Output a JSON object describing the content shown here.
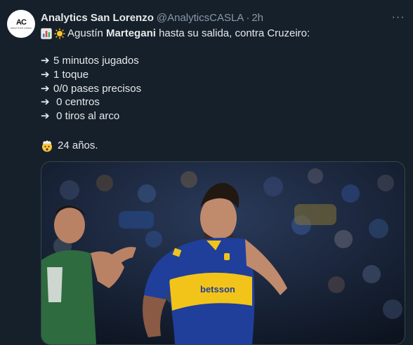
{
  "tweet": {
    "author_name": "Analytics San Lorenzo",
    "handle": "@AnalyticsCASLA",
    "separator": "·",
    "time": "2h",
    "avatar_text": "AC",
    "avatar_subtext": "ANALYTICS CASLA",
    "line1_pre": "Agustín ",
    "line1_bold": "Martegani",
    "line1_post": " hasta su salida, contra Cruzeiro:",
    "arrow": "➔",
    "stats": [
      "5 minutos jugados",
      "1 toque",
      "0/0 pases precisos",
      " 0 centros",
      " 0 tiros al arco"
    ],
    "age_text": "24 años.",
    "emojis": [
      "bar-chart-icon",
      "sun-icon",
      "exploding-head-icon"
    ]
  },
  "colors": {
    "background": "#15202b",
    "text": "#e7e9ea",
    "muted": "#8b98a5",
    "boca_blue": "#1f3f9a",
    "boca_yellow": "#f2c41a",
    "opponent_green": "#2e6b3f"
  }
}
